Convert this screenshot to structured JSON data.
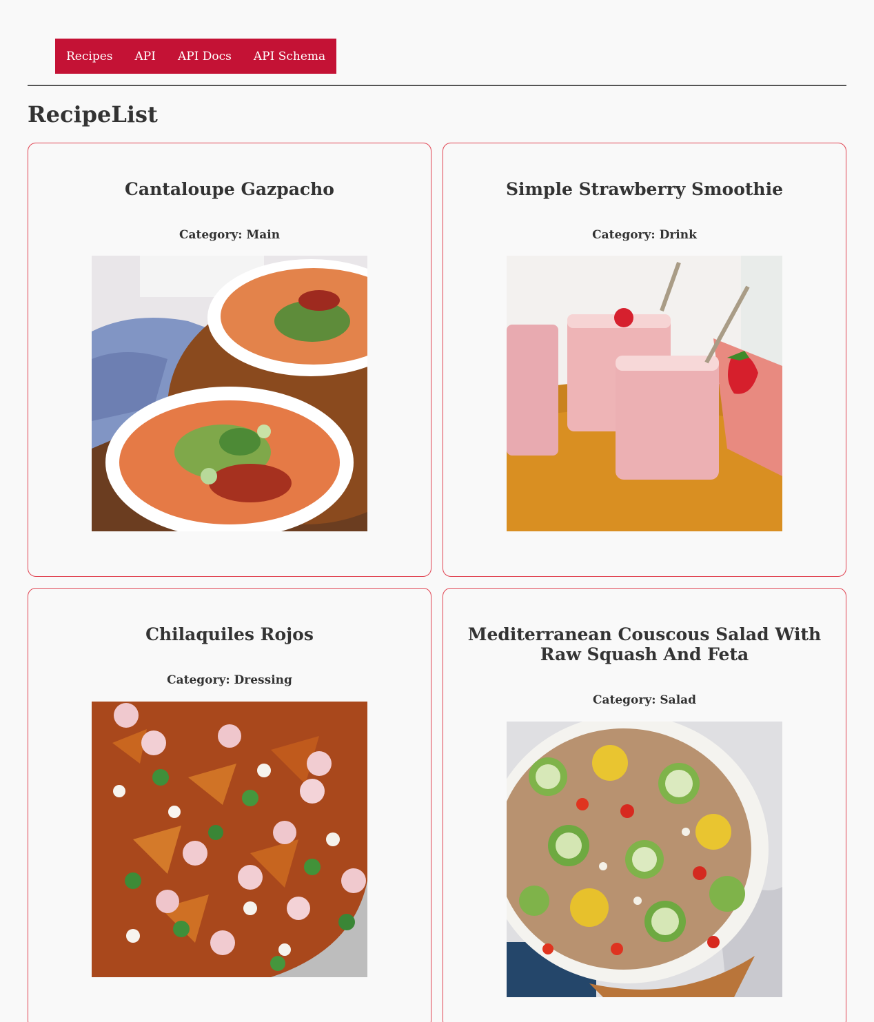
{
  "nav": {
    "items": [
      {
        "label": "Recipes"
      },
      {
        "label": "API"
      },
      {
        "label": "API Docs"
      },
      {
        "label": "API Schema"
      }
    ]
  },
  "page": {
    "title": "RecipeList"
  },
  "recipes": [
    {
      "title": "Cantaloupe Gazpacho",
      "category": "Category: Main"
    },
    {
      "title": "Simple Strawberry Smoothie",
      "category": "Category: Drink"
    },
    {
      "title": "Chilaquiles Rojos",
      "category": "Category: Dressing"
    },
    {
      "title": "Mediterranean Couscous Salad With Raw Squash And Feta",
      "category": "Category: Salad"
    }
  ],
  "colors": {
    "nav_background": "#c41235",
    "card_border": "#e0414f",
    "page_background": "#f9f9f9",
    "text": "#333333"
  }
}
